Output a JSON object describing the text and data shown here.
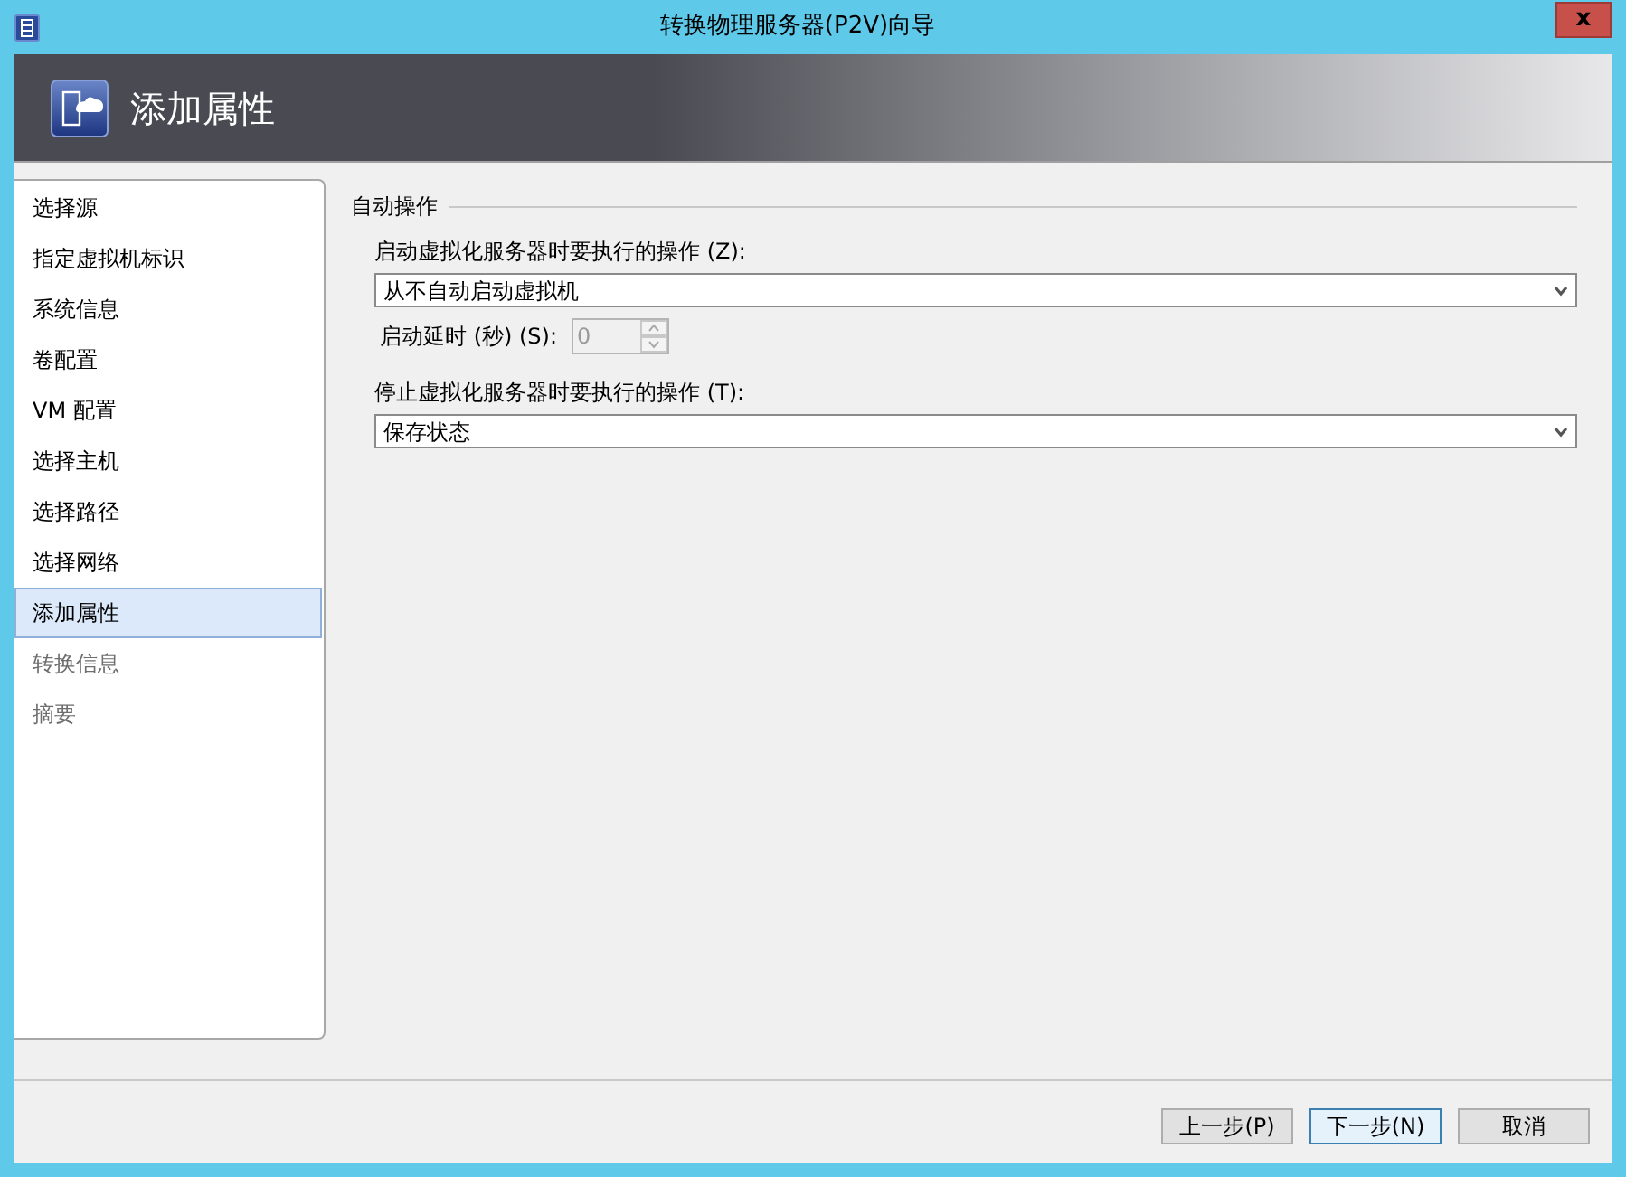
{
  "window": {
    "title": "转换物理服务器(P2V)向导",
    "close": "x"
  },
  "header": {
    "title": "添加属性"
  },
  "steps": [
    {
      "label": "选择源",
      "selected": false,
      "disabled": false
    },
    {
      "label": "指定虚拟机标识",
      "selected": false,
      "disabled": false
    },
    {
      "label": "系统信息",
      "selected": false,
      "disabled": false
    },
    {
      "label": "卷配置",
      "selected": false,
      "disabled": false
    },
    {
      "label": "VM 配置",
      "selected": false,
      "disabled": false
    },
    {
      "label": "选择主机",
      "selected": false,
      "disabled": false
    },
    {
      "label": "选择路径",
      "selected": false,
      "disabled": false
    },
    {
      "label": "选择网络",
      "selected": false,
      "disabled": false
    },
    {
      "label": "添加属性",
      "selected": true,
      "disabled": false
    },
    {
      "label": "转换信息",
      "selected": false,
      "disabled": true
    },
    {
      "label": "摘要",
      "selected": false,
      "disabled": true
    }
  ],
  "group": {
    "title": "自动操作",
    "start_action": {
      "label": "启动虚拟化服务器时要执行的操作 (Z):",
      "value": "从不自动启动虚拟机"
    },
    "delay": {
      "label": "启动延时 (秒) (S):",
      "value": "0",
      "disabled": true
    },
    "stop_action": {
      "label": "停止虚拟化服务器时要执行的操作 (T):",
      "value": "保存状态"
    }
  },
  "buttons": [
    {
      "label": "上一步(P)",
      "default": false
    },
    {
      "label": "下一步(N)",
      "default": true
    },
    {
      "label": "取消",
      "default": false
    }
  ]
}
